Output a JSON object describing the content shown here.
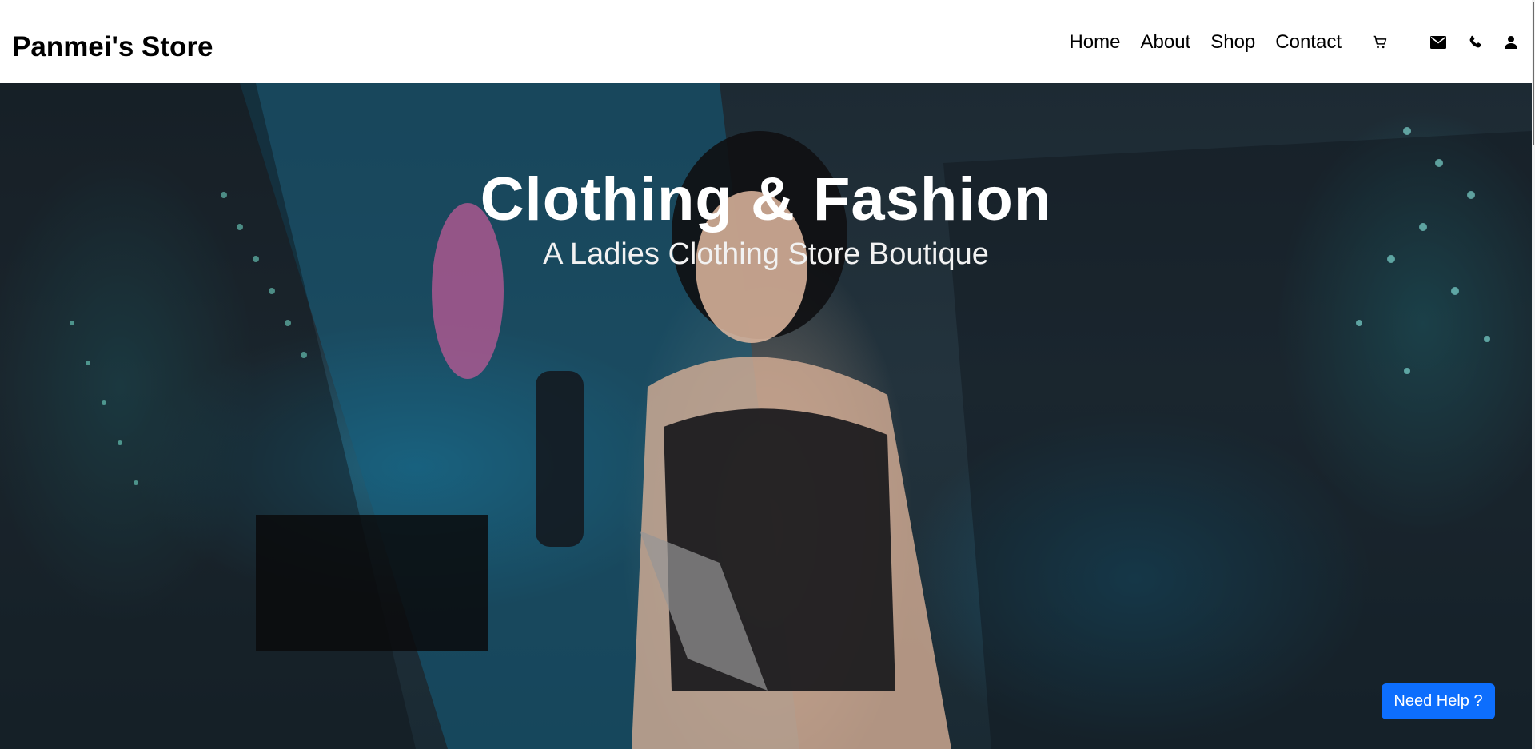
{
  "header": {
    "brand": "Panmei's Store",
    "nav": {
      "home": "Home",
      "about": "About",
      "shop": "Shop",
      "contact": "Contact"
    },
    "icons": [
      "cart-icon",
      "mail-icon",
      "phone-icon",
      "user-icon"
    ]
  },
  "hero": {
    "title": "Clothing & Fashion",
    "subtitle": "A Ladies Clothing Store Boutique"
  },
  "help": {
    "label": "Need Help ?"
  },
  "colors": {
    "help_button": "#0d6efd",
    "header_bg": "#ffffff",
    "text": "#000000"
  }
}
